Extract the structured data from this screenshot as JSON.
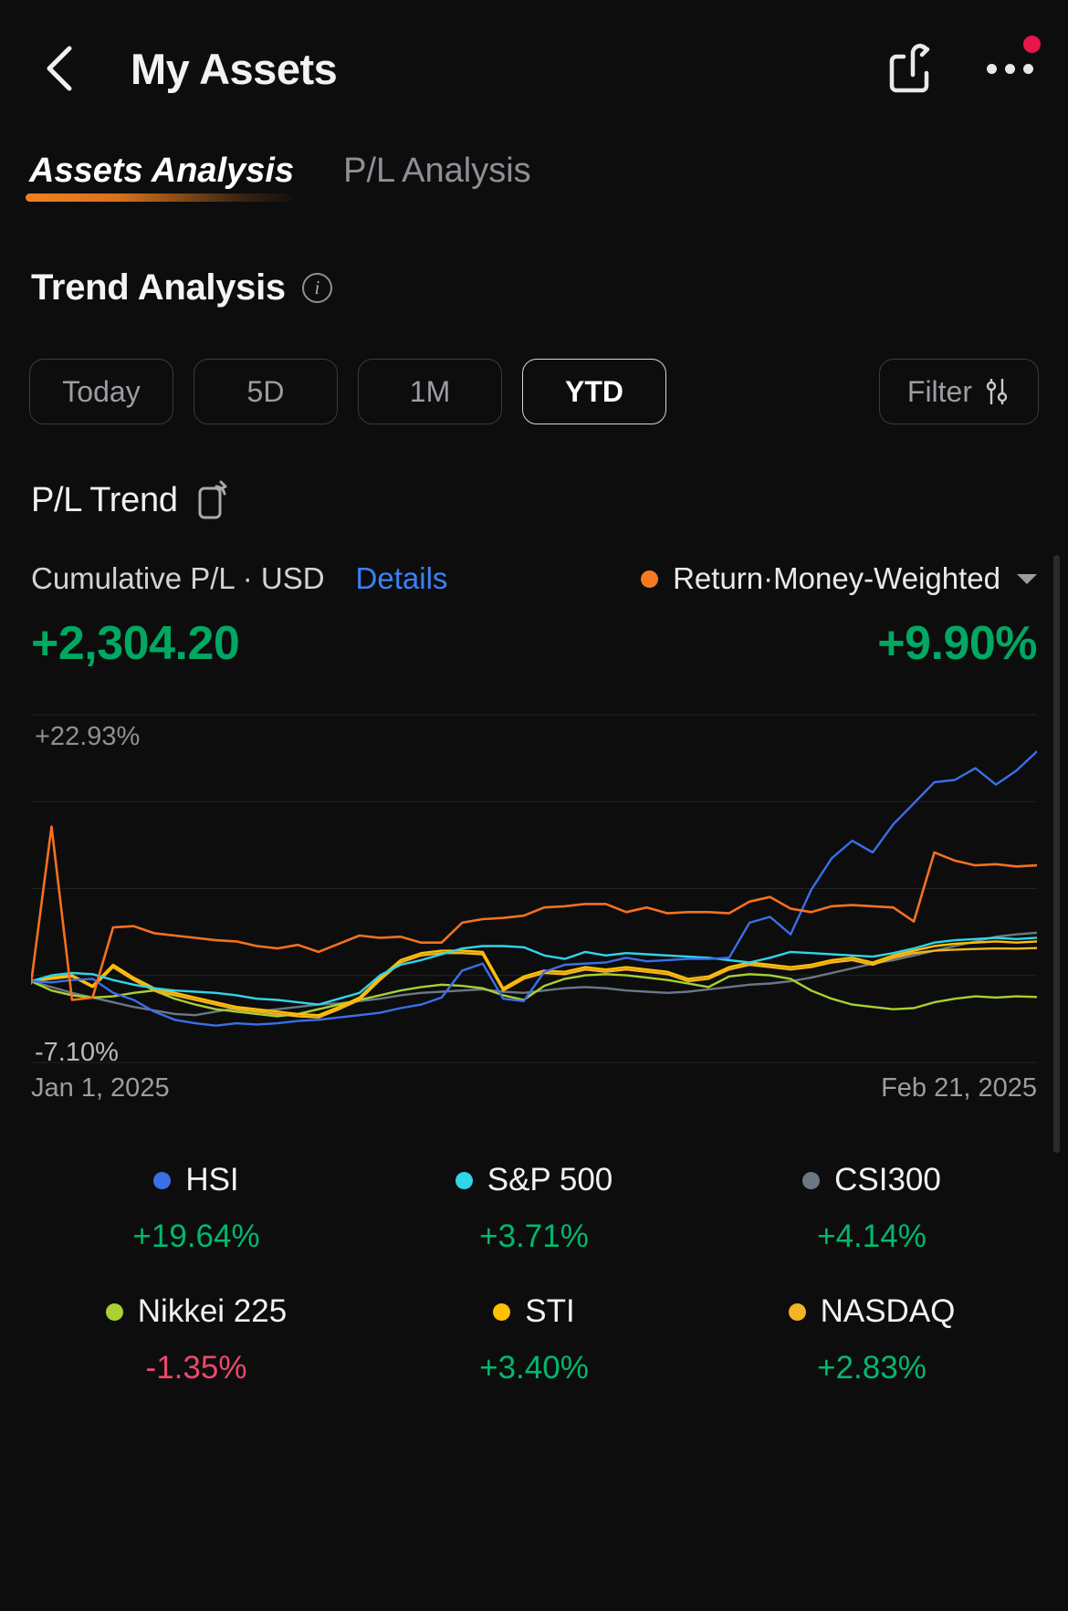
{
  "header": {
    "title": "My Assets",
    "back_icon": "chevron-left-icon",
    "share_icon": "share-icon",
    "more_icon": "more-horizontal-icon",
    "has_notification_badge": true
  },
  "tabs": [
    {
      "label": "Assets Analysis",
      "active": true
    },
    {
      "label": "P/L Analysis",
      "active": false
    }
  ],
  "section": {
    "title": "Trend Analysis",
    "info_icon": "info-icon"
  },
  "ranges": [
    {
      "label": "Today",
      "active": false
    },
    {
      "label": "5D",
      "active": false
    },
    {
      "label": "1M",
      "active": false
    },
    {
      "label": "YTD",
      "active": true
    }
  ],
  "filter": {
    "label": "Filter",
    "icon": "filter-sliders-icon"
  },
  "pl_trend": {
    "title": "P/L Trend",
    "expand_icon": "rotate-screen-icon",
    "left_label": "Cumulative P/L · USD",
    "details_link": "Details",
    "right_label": "Return·Money-Weighted",
    "right_dot_color": "#f57a20",
    "caret_icon": "chevron-down-icon",
    "left_value": "+2,304.20",
    "right_value": "+9.90%",
    "value_color": "#00a862"
  },
  "chart_data": {
    "type": "line",
    "title": "P/L Trend",
    "xlabel": "",
    "ylabel": "",
    "ylim": [
      -7.1,
      22.93
    ],
    "ytick_labels": [
      "+22.93%",
      "-7.10%"
    ],
    "x_start": "Jan 1, 2025",
    "x_end": "Feb 21, 2025",
    "grid": true,
    "gridline_count": 5,
    "legend_position": "bottom",
    "series": [
      {
        "name": "Return·Money-Weighted",
        "color": "#f57120",
        "final_value": 9.9,
        "values": [
          -0.2,
          13.2,
          -1.6,
          -1.4,
          4.6,
          4.7,
          4.1,
          3.9,
          3.7,
          3.5,
          3.4,
          3.0,
          2.8,
          3.1,
          2.5,
          3.2,
          3.9,
          3.7,
          3.8,
          3.3,
          3.3,
          5.0,
          5.3,
          5.4,
          5.6,
          6.3,
          6.4,
          6.6,
          6.6,
          5.9,
          6.3,
          5.8,
          5.9,
          5.9,
          5.8,
          6.8,
          7.2,
          6.2,
          5.9,
          6.4,
          6.5,
          6.4,
          6.3,
          5.1,
          11.0,
          10.3,
          9.9,
          10.0,
          9.8,
          9.9
        ]
      },
      {
        "name": "HSI",
        "color": "#3b6fe8",
        "final_value": 19.64,
        "values": [
          0.0,
          -0.1,
          0.1,
          0.2,
          -1.0,
          -1.6,
          -2.6,
          -3.3,
          -3.6,
          -3.8,
          -3.6,
          -3.7,
          -3.6,
          -3.4,
          -3.3,
          -3.1,
          -2.9,
          -2.7,
          -2.3,
          -2.0,
          -1.4,
          0.9,
          1.5,
          -1.5,
          -1.7,
          0.8,
          1.4,
          1.5,
          1.6,
          2.0,
          1.7,
          1.8,
          1.9,
          1.9,
          2.0,
          5.0,
          5.5,
          4.0,
          7.8,
          10.5,
          12.0,
          11.0,
          13.4,
          15.2,
          17.0,
          17.2,
          18.2,
          16.8,
          18.0,
          19.64
        ]
      },
      {
        "name": "S&P 500",
        "color": "#30d5e8",
        "final_value": 3.71,
        "values": [
          0.0,
          0.5,
          0.7,
          0.6,
          0.1,
          -0.3,
          -0.6,
          -0.8,
          -0.9,
          -1.0,
          -1.2,
          -1.5,
          -1.6,
          -1.8,
          -2.0,
          -1.5,
          -1.0,
          0.5,
          1.4,
          1.8,
          2.3,
          2.8,
          3.0,
          3.0,
          2.9,
          2.2,
          1.9,
          2.5,
          2.2,
          2.4,
          2.3,
          2.2,
          2.1,
          2.0,
          1.8,
          1.6,
          2.0,
          2.5,
          2.4,
          2.3,
          2.2,
          2.1,
          2.4,
          2.8,
          3.3,
          3.5,
          3.6,
          3.7,
          3.6,
          3.71
        ]
      },
      {
        "name": "CSI300",
        "color": "#6b7785",
        "final_value": 4.14,
        "values": [
          0.0,
          -0.5,
          -1.0,
          -1.4,
          -1.8,
          -2.2,
          -2.5,
          -2.8,
          -2.9,
          -2.6,
          -2.3,
          -2.6,
          -2.4,
          -2.2,
          -2.0,
          -1.9,
          -1.7,
          -1.5,
          -1.2,
          -1.0,
          -0.9,
          -0.8,
          -0.7,
          -0.9,
          -1.0,
          -0.8,
          -0.6,
          -0.5,
          -0.6,
          -0.8,
          -0.9,
          -1.0,
          -0.9,
          -0.7,
          -0.5,
          -0.3,
          -0.2,
          0.0,
          0.3,
          0.7,
          1.1,
          1.5,
          1.8,
          2.2,
          2.6,
          3.0,
          3.4,
          3.8,
          4.0,
          4.14
        ]
      },
      {
        "name": "Nikkei 225",
        "color": "#a8d131",
        "final_value": -1.35,
        "values": [
          0.0,
          -0.8,
          -1.2,
          -1.4,
          -1.3,
          -1.0,
          -0.8,
          -1.5,
          -2.0,
          -2.4,
          -2.6,
          -2.8,
          -3.0,
          -2.8,
          -2.4,
          -2.0,
          -1.6,
          -1.2,
          -0.8,
          -0.5,
          -0.3,
          -0.4,
          -0.6,
          -1.2,
          -1.6,
          -0.4,
          0.2,
          0.5,
          0.6,
          0.5,
          0.3,
          0.1,
          -0.2,
          -0.5,
          0.4,
          0.6,
          0.5,
          0.2,
          -0.8,
          -1.5,
          -2.0,
          -2.2,
          -2.4,
          -2.3,
          -1.8,
          -1.5,
          -1.3,
          -1.4,
          -1.3,
          -1.35
        ]
      },
      {
        "name": "STI",
        "color": "#ffc000",
        "final_value": 3.4,
        "values": [
          0.0,
          0.3,
          0.5,
          -0.4,
          1.4,
          0.3,
          -0.6,
          -1.0,
          -1.4,
          -1.8,
          -2.2,
          -2.4,
          -2.6,
          -2.8,
          -2.9,
          -2.2,
          -1.4,
          0.3,
          1.8,
          2.4,
          2.6,
          2.6,
          2.5,
          -0.6,
          0.4,
          0.9,
          0.8,
          1.2,
          1.0,
          1.2,
          1.0,
          0.8,
          0.2,
          0.4,
          1.2,
          1.6,
          1.4,
          1.2,
          1.4,
          1.8,
          2.0,
          1.6,
          2.2,
          2.6,
          3.0,
          3.2,
          3.3,
          3.4,
          3.3,
          3.4
        ]
      },
      {
        "name": "NASDAQ",
        "color": "#f5b325",
        "final_value": 2.83,
        "values": [
          0.0,
          0.2,
          0.4,
          -0.5,
          1.2,
          0.1,
          -0.8,
          -1.2,
          -1.6,
          -2.0,
          -2.4,
          -2.6,
          -2.8,
          -3.0,
          -3.1,
          -2.4,
          -1.6,
          0.1,
          1.6,
          2.2,
          2.4,
          2.4,
          2.3,
          -0.8,
          0.2,
          0.7,
          0.6,
          1.0,
          0.8,
          1.0,
          0.8,
          0.6,
          0.0,
          0.2,
          1.0,
          1.4,
          1.2,
          1.0,
          1.2,
          1.6,
          1.8,
          1.4,
          2.0,
          2.4,
          2.6,
          2.7,
          2.75,
          2.8,
          2.78,
          2.83
        ]
      }
    ]
  },
  "legend": [
    {
      "name": "HSI",
      "color": "#3b6fe8",
      "value": "+19.64%",
      "positive": true
    },
    {
      "name": "S&P 500",
      "color": "#30d5e8",
      "value": "+3.71%",
      "positive": true
    },
    {
      "name": "CSI300",
      "color": "#6b7785",
      "value": "+4.14%",
      "positive": true
    },
    {
      "name": "Nikkei 225",
      "color": "#a8d131",
      "value": "-1.35%",
      "positive": false
    },
    {
      "name": "STI",
      "color": "#ffc000",
      "value": "+3.40%",
      "positive": true
    },
    {
      "name": "NASDAQ",
      "color": "#f5b325",
      "value": "+2.83%",
      "positive": true
    }
  ]
}
